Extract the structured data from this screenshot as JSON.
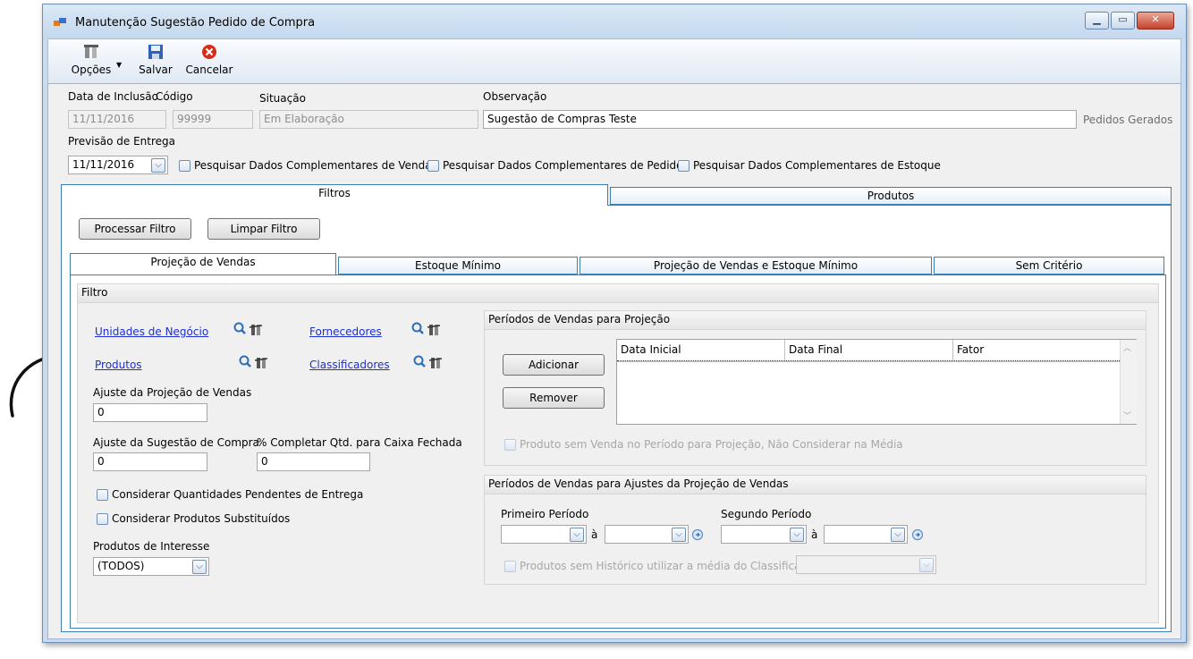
{
  "window": {
    "title": "Manutenção Sugestão Pedido de Compra",
    "minimize": "▁",
    "maximize": "▭",
    "close": "✕"
  },
  "toolbar": {
    "options_label": "Opções",
    "save_label": "Salvar",
    "cancel_label": "Cancelar"
  },
  "header": {
    "inclusion_date_label": "Data de Inclusão",
    "inclusion_date_value": "11/11/2016",
    "code_label": "Código",
    "code_value": "99999",
    "status_label": "Situação",
    "status_value": "Em Elaboração",
    "notes_label": "Observação",
    "notes_value": "Sugestão de Compras Teste",
    "orders_generated_label": "Pedidos Gerados",
    "delivery_forecast_label": "Previsão de Entrega",
    "delivery_forecast_value": "11/11/2016",
    "check_sales_label": "Pesquisar Dados Complementares de Venda",
    "check_order_label": "Pesquisar Dados Complementares de Pedido",
    "check_stock_label": "Pesquisar Dados Complementares de Estoque"
  },
  "main_tabs": [
    {
      "label": "Filtros"
    },
    {
      "label": "Produtos"
    }
  ],
  "filter_buttons": {
    "process_label": "Processar Filtro",
    "clear_label": "Limpar Filtro"
  },
  "sub_tabs": [
    {
      "label": "Projeção de Vendas"
    },
    {
      "label": "Estoque Mínimo"
    },
    {
      "label": "Projeção de Vendas e Estoque Mínimo"
    },
    {
      "label": "Sem Critério"
    }
  ],
  "filter": {
    "title": "Filtro",
    "business_units_link": "Unidades de Negócio",
    "suppliers_link": "Fornecedores",
    "products_link": "Produtos",
    "classifiers_link": "Classificadores",
    "sales_projection_adjust_label": "Ajuste da Projeção de Vendas",
    "sales_projection_adjust_value": "0",
    "purchase_suggestion_adjust_label": "Ajuste da Sugestão de Compra",
    "purchase_suggestion_adjust_value": "0",
    "complete_box_label": "% Completar Qtd. para Caixa Fechada",
    "complete_box_value": "0",
    "consider_pending_label": "Considerar Quantidades Pendentes de Entrega",
    "consider_substitutes_label": "Considerar Produtos Substituídos",
    "products_interest_label": "Produtos de Interesse",
    "products_interest_value": "(TODOS)"
  },
  "projection_periods": {
    "title": "Períodos de Vendas para Projeção",
    "add_label": "Adicionar",
    "remove_label": "Remover",
    "columns": [
      "Data Inicial",
      "Data Final",
      "Fator"
    ],
    "no_sales_label": "Produto sem Venda no Período para Projeção, Não Considerar na Média"
  },
  "adjust_periods": {
    "title": "Períodos de Vendas para Ajustes da Projeção de Vendas",
    "first_period_label": "Primeiro Período",
    "second_period_label": "Segundo Período",
    "to_label_1": "à",
    "to_label_2": "à",
    "no_history_label": "Produtos sem Histórico utilizar a média do Classificador"
  }
}
